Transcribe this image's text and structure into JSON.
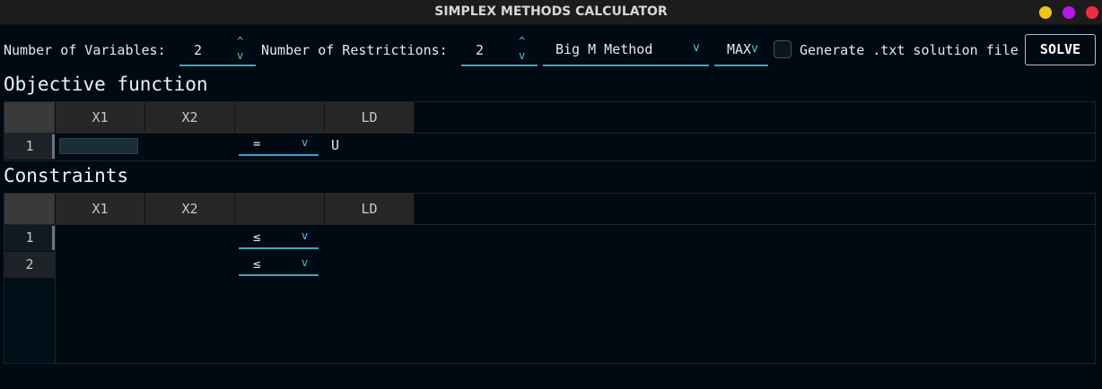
{
  "window": {
    "title": "SIMPLEX METHODS CALCULATOR"
  },
  "toolbar": {
    "variables_label": "Number of Variables:",
    "variables_value": "2",
    "restrictions_label": "Number of Restrictions:",
    "restrictions_value": "2",
    "method_value": "Big M Method",
    "objective_type": "MAX",
    "generate_label": "Generate .txt solution file",
    "generate_checked": false,
    "solve_label": "SOLVE"
  },
  "icons": {
    "spin_up": "^",
    "spin_down": "v",
    "dropdown": "v"
  },
  "objective": {
    "title": "Objective function",
    "columns": [
      "X1",
      "X2",
      "",
      "LD"
    ],
    "rows": [
      {
        "index": "1",
        "x1": "",
        "x2": "",
        "sign": "=",
        "ld": "U"
      }
    ]
  },
  "constraints": {
    "title": "Constraints",
    "columns": [
      "X1",
      "X2",
      "",
      "LD"
    ],
    "rows": [
      {
        "index": "1",
        "x1": "",
        "x2": "",
        "sign": "≤",
        "ld": ""
      },
      {
        "index": "2",
        "x1": "",
        "x2": "",
        "sign": "≤",
        "ld": ""
      }
    ]
  },
  "colors": {
    "background": "#000a12",
    "accent": "#3aa6c9",
    "titlebar": "#1c1c1c",
    "minimize": "#f2c318",
    "maximize": "#b719e6",
    "close": "#ef2d40"
  }
}
